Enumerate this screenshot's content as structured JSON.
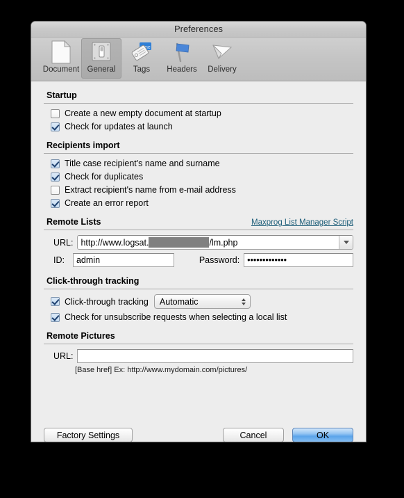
{
  "window": {
    "title": "Preferences"
  },
  "toolbar": {
    "items": [
      {
        "label": "Document",
        "icon": "document-icon",
        "selected": false
      },
      {
        "label": "General",
        "icon": "general-icon",
        "selected": true
      },
      {
        "label": "Tags",
        "icon": "tags-icon",
        "selected": false
      },
      {
        "label": "Headers",
        "icon": "flag-icon",
        "selected": false
      },
      {
        "label": "Delivery",
        "icon": "paper-plane-icon",
        "selected": false
      }
    ]
  },
  "sections": {
    "startup": {
      "title": "Startup",
      "options": [
        {
          "label": "Create a new empty document at startup",
          "checked": false
        },
        {
          "label": "Check for updates at launch",
          "checked": true
        }
      ]
    },
    "recipients_import": {
      "title": "Recipients import",
      "options": [
        {
          "label": "Title case recipient's name and surname",
          "checked": true
        },
        {
          "label": "Check for duplicates",
          "checked": true
        },
        {
          "label": "Extract recipient's name from e-mail address",
          "checked": false
        },
        {
          "label": "Create an error report",
          "checked": true
        }
      ]
    },
    "remote_lists": {
      "title": "Remote Lists",
      "link_label": "Maxprog List Manager Script",
      "url_label": "URL:",
      "url_prefix": "http://www.logsat.",
      "url_suffix": "/lm.php",
      "url_redacted": true,
      "id_label": "ID:",
      "id_value": "admin",
      "password_label": "Password:",
      "password_value": "•••••••••••••"
    },
    "click_through": {
      "title": "Click-through tracking",
      "checkbox_label": "Click-through tracking",
      "checkbox_checked": true,
      "mode_value": "Automatic",
      "unsubscribe_label": "Check for unsubscribe requests when selecting a local list",
      "unsubscribe_checked": true
    },
    "remote_pictures": {
      "title": "Remote Pictures",
      "url_label": "URL:",
      "url_value": "",
      "url_placeholder": "",
      "hint": "[Base href] Ex: http://www.mydomain.com/pictures/"
    }
  },
  "footer": {
    "factory_settings_label": "Factory Settings",
    "cancel_label": "Cancel",
    "ok_label": "OK"
  },
  "colors": {
    "window_bg": "#ededed",
    "link": "#1f5f7a",
    "primary_button": "#5ba4ea",
    "redaction": "#808080",
    "flag_blue": "#4a86d8",
    "tag_blue": "#2f7fd6"
  }
}
